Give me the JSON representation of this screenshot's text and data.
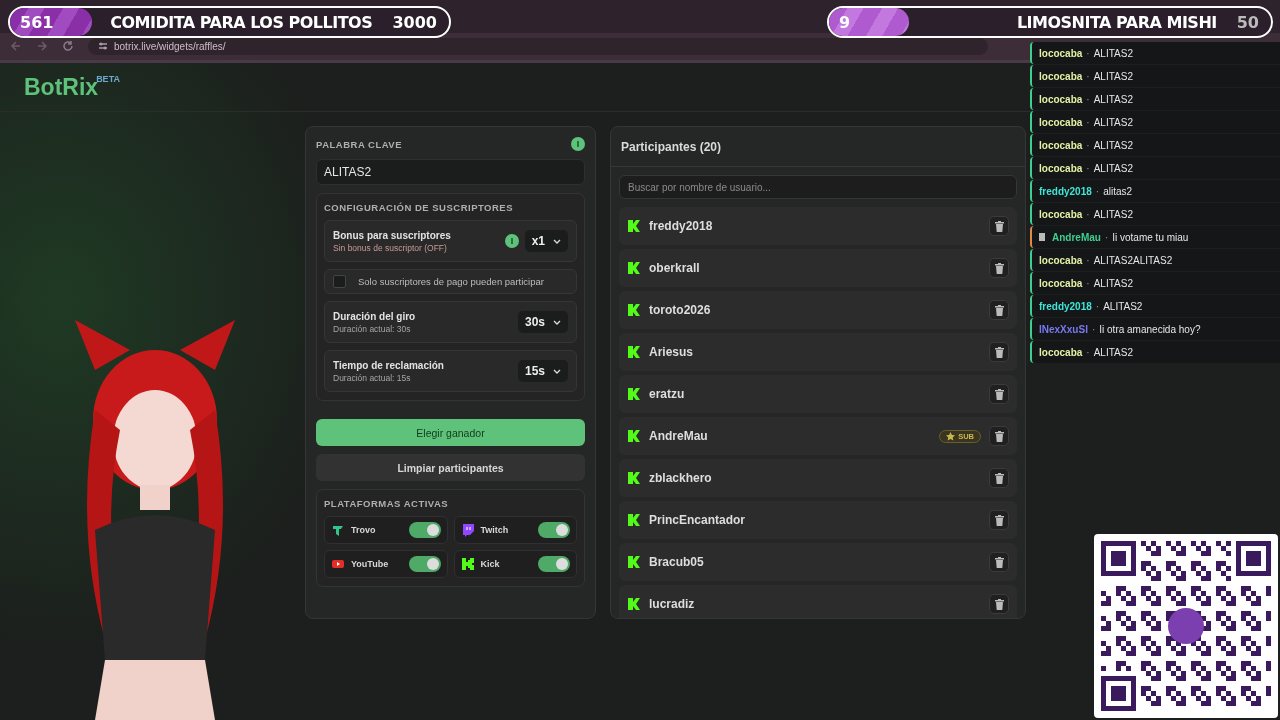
{
  "browser": {
    "url": "botrix.live/widgets/raffles/"
  },
  "goals": [
    {
      "count": "561",
      "title": "COMIDITA PARA LOS POLLITOS",
      "target": "3000",
      "level": 0.187
    },
    {
      "count": "9",
      "title": "LIMOSNITA PARA MISHI",
      "target": "50",
      "level": 0.18
    }
  ],
  "header": {
    "logo": "BotRix",
    "badge": "BETA"
  },
  "settings": {
    "keyword_label": "PALABRA CLAVE",
    "keyword_value": "ALITAS2",
    "subscribers_title": "CONFIGURACIÓN DE SUSCRIPTORES",
    "rows": [
      {
        "kind": "select",
        "title": "Bonus para suscriptores",
        "subtitle": "Sin bonus de suscriptor (OFF)",
        "warning": true,
        "info": true,
        "value": "x1"
      },
      {
        "kind": "checkbox",
        "title": "Solo suscriptores de pago pueden participar",
        "checked": false
      },
      {
        "kind": "select",
        "title": "Duración del giro",
        "subtitle": "Duración actual: 30s",
        "warning": false,
        "info": false,
        "value": "30s"
      },
      {
        "kind": "select",
        "title": "Tiempo de reclamación",
        "subtitle": "Duración actual: 15s",
        "warning": false,
        "info": false,
        "value": "15s"
      }
    ],
    "buttons": [
      {
        "label": "Elegir ganador",
        "kind": "primary"
      },
      {
        "label": "Limpiar participantes",
        "kind": "secondary"
      }
    ],
    "platforms_title": "PLATAFORMAS ACTIVAS",
    "platforms": [
      {
        "kind": "trovo",
        "name": "Trovo",
        "on": true
      },
      {
        "kind": "twitch",
        "name": "Twitch",
        "on": true
      },
      {
        "kind": "youtube",
        "name": "YouTube",
        "on": true
      },
      {
        "kind": "kick",
        "name": "Kick",
        "on": true
      }
    ]
  },
  "participants": {
    "title": "Participantes (20)",
    "search": {
      "placeholder": "Buscar por nombre de usuario..."
    },
    "rows": [
      {
        "name": "freddy2018",
        "sub": false
      },
      {
        "name": "oberkrall",
        "sub": false
      },
      {
        "name": "toroto2026",
        "sub": false
      },
      {
        "name": "Ariesus",
        "sub": false
      },
      {
        "name": "eratzu",
        "sub": false
      },
      {
        "name": "AndreMau",
        "sub": true,
        "badge": "SUB"
      },
      {
        "name": "zblackhero",
        "sub": false
      },
      {
        "name": "PrincEncantador",
        "sub": false
      },
      {
        "name": "Bracub05",
        "sub": false
      },
      {
        "name": "lucradiz",
        "sub": false
      }
    ]
  },
  "chat": {
    "separator": "·",
    "messages": [
      {
        "user": "lococaba",
        "text": "ALITAS2",
        "color": "#e4f0a4",
        "subscriber": false
      },
      {
        "user": "lococaba",
        "text": "ALITAS2",
        "color": "#e4f0a4",
        "subscriber": false
      },
      {
        "user": "lococaba",
        "text": "ALITAS2",
        "color": "#e4f0a4",
        "subscriber": false
      },
      {
        "user": "lococaba",
        "text": "ALITAS2",
        "color": "#e4f0a4",
        "subscriber": false
      },
      {
        "user": "lococaba",
        "text": "ALITAS2",
        "color": "#e4f0a4",
        "subscriber": false
      },
      {
        "user": "lococaba",
        "text": "ALITAS2",
        "color": "#e4f0a4",
        "subscriber": false
      },
      {
        "user": "freddy2018",
        "text": "alitas2",
        "color": "#3ee6d6",
        "subscriber": false
      },
      {
        "user": "lococaba",
        "text": "ALITAS2",
        "color": "#e4f0a4",
        "subscriber": false
      },
      {
        "user": "AndreMau",
        "text": "Ii votame tu miau",
        "color": "#3ecf8e",
        "subscriber": true
      },
      {
        "user": "lococaba",
        "text": "ALITAS2ALITAS2",
        "color": "#e4f0a4",
        "subscriber": false
      },
      {
        "user": "lococaba",
        "text": "ALITAS2",
        "color": "#e4f0a4",
        "subscriber": false
      },
      {
        "user": "freddy2018",
        "text": "ALITAS2",
        "color": "#3ee6d6",
        "subscriber": false
      },
      {
        "user": "INexXxuSI",
        "text": "Ii otra amanecida hoy?",
        "color": "#7a78f0",
        "subscriber": false
      },
      {
        "user": "lococaba",
        "text": "ALITAS2",
        "color": "#e4f0a4",
        "subscriber": false
      }
    ]
  }
}
